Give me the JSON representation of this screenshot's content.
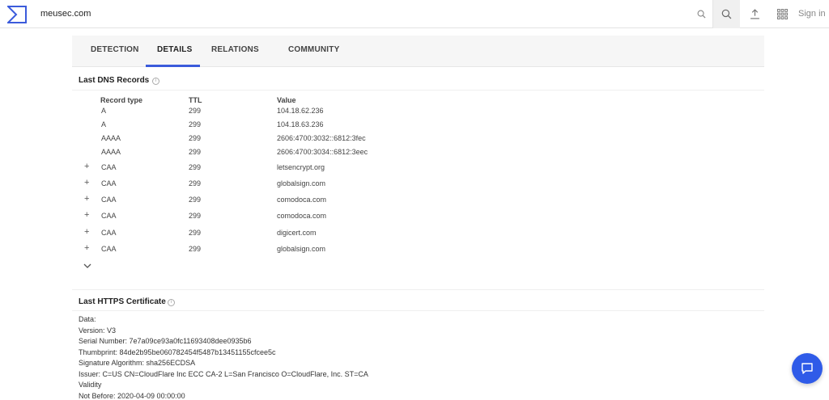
{
  "header": {
    "search_value": "meusec.com",
    "signin_label": "Sign in",
    "brand_color": "#3b5bdb"
  },
  "tabs": [
    {
      "label": "DETECTION"
    },
    {
      "label": "DETAILS",
      "active": true
    },
    {
      "label": "RELATIONS"
    },
    {
      "label": "COMMUNITY"
    }
  ],
  "dns": {
    "title": "Last DNS Records",
    "columns": {
      "type": "Record type",
      "ttl": "TTL",
      "value": "Value"
    },
    "rows": [
      {
        "expand": "",
        "type": "A",
        "ttl": "299",
        "value": "104.18.62.236"
      },
      {
        "expand": "",
        "type": "A",
        "ttl": "299",
        "value": "104.18.63.236"
      },
      {
        "expand": "",
        "type": "AAAA",
        "ttl": "299",
        "value": "2606:4700:3032::6812:3fec"
      },
      {
        "expand": "",
        "type": "AAAA",
        "ttl": "299",
        "value": "2606:4700:3034::6812:3eec"
      },
      {
        "expand": "+",
        "type": "CAA",
        "ttl": "299",
        "value": "letsencrypt.org"
      },
      {
        "expand": "+",
        "type": "CAA",
        "ttl": "299",
        "value": "globalsign.com"
      },
      {
        "expand": "+",
        "type": "CAA",
        "ttl": "299",
        "value": "comodoca.com"
      },
      {
        "expand": "+",
        "type": "CAA",
        "ttl": "299",
        "value": "comodoca.com"
      },
      {
        "expand": "+",
        "type": "CAA",
        "ttl": "299",
        "value": "digicert.com"
      },
      {
        "expand": "+",
        "type": "CAA",
        "ttl": "299",
        "value": "globalsign.com"
      }
    ]
  },
  "certificate": {
    "title": "Last HTTPS Certificate",
    "lines": [
      "Data:",
      "Version: V3",
      "Serial Number: 7e7a09ce93a0fc11693408dee0935b6",
      "Thumbprint: 84de2b95be060782454f5487b13451155cfcee5c",
      "Signature Algorithm: sha256ECDSA",
      "Issuer: C=US CN=CloudFlare Inc ECC CA-2 L=San Francisco O=CloudFlare, Inc. ST=CA",
      "Validity",
      "Not Before: 2020-04-09 00:00:00"
    ]
  }
}
